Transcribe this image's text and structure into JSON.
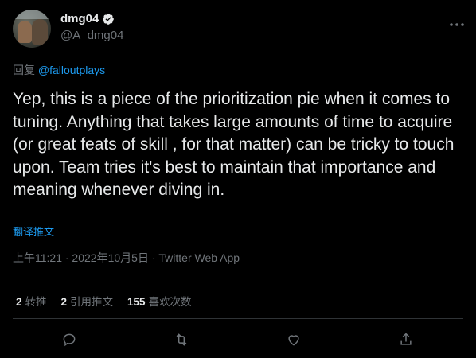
{
  "author": {
    "display_name": "dmg04",
    "handle": "@A_dmg04"
  },
  "more_icon": "more-icon",
  "reply": {
    "prefix": "回复 ",
    "mention": "@falloutplays"
  },
  "tweet": {
    "text": "Yep, this is a piece of the prioritization pie when it comes to tuning. Anything that takes large amounts of time to acquire (or great feats of skill , for that matter) can be tricky to touch upon. Team tries it's best to maintain that importance and meaning whenever diving in.",
    "translate_label": "翻译推文"
  },
  "meta": {
    "timestamp": "上午11:21 · 2022年10月5日 · Twitter Web App"
  },
  "stats": {
    "retweets_count": "2",
    "retweets_label": "转推",
    "quotes_count": "2",
    "quotes_label": "引用推文",
    "likes_count": "155",
    "likes_label": "喜欢次数"
  },
  "actions": [
    "reply-icon",
    "retweet-icon",
    "like-icon",
    "share-icon"
  ],
  "colors": {
    "background": "#000000",
    "text": "#e7e9ea",
    "secondary": "#71767b",
    "accent": "#1d9bf0",
    "divider": "#2f3336"
  }
}
